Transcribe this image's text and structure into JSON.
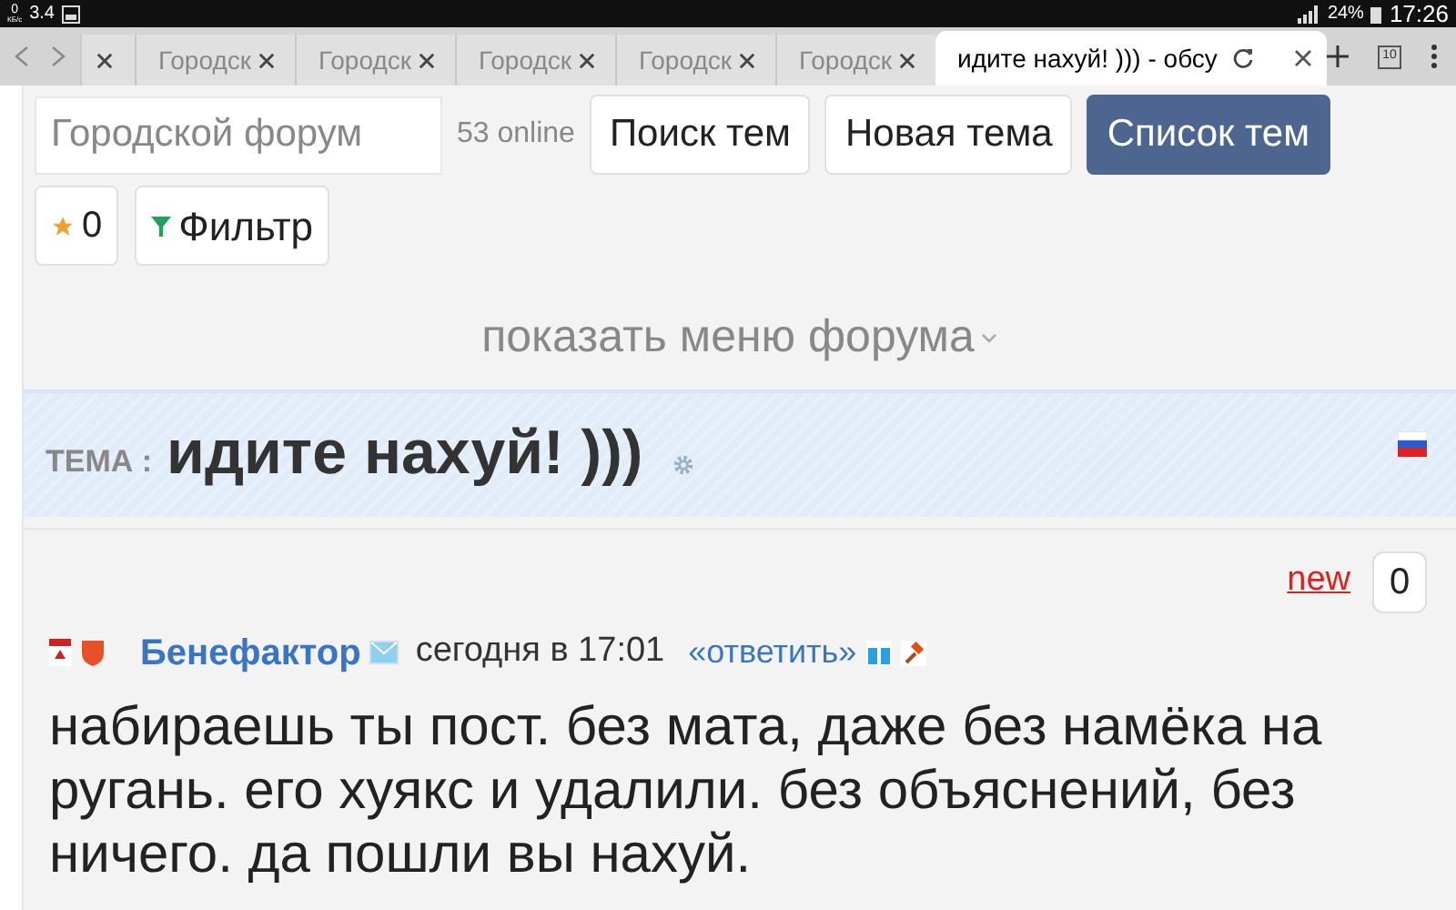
{
  "status_bar": {
    "net_speed": "0",
    "net_unit": "КБ/с",
    "version": "3.4",
    "battery": "24%",
    "time": "17:26"
  },
  "browser": {
    "tabs": [
      {
        "selected": false
      },
      {
        "title": "Городск",
        "selected": false
      },
      {
        "title": "Городск",
        "selected": false
      },
      {
        "title": "Городск",
        "selected": false
      },
      {
        "title": "Городск",
        "selected": false
      },
      {
        "title": "Городск",
        "selected": false
      },
      {
        "title": "идите нахуй! ))) - обсу",
        "selected": true
      }
    ],
    "tab_count": "10"
  },
  "forum_header": {
    "search": {
      "placeholder": "Городской форум"
    },
    "online": "53 online",
    "buttons": [
      {
        "label": "Поиск тем",
        "selected": false
      },
      {
        "label": "Новая тема",
        "selected": false
      },
      {
        "label": "Список тем",
        "selected": true
      }
    ],
    "favorites_count": "0",
    "filter_label": "Фильтр",
    "menu_toggle": "показать меню форума"
  },
  "topic": {
    "prefix": "ТЕМА :",
    "title": "идите нахуй! )))"
  },
  "post": {
    "new_label": "new",
    "counter": "0",
    "author": "Бенефактор",
    "time": "сегодня в 17:01",
    "reply_link": "«ответить»",
    "text": "набираешь ты пост. без мата, даже без намёка на ругань. его хуякс и удалили. без объяснений, без ничего. да пошли вы нахуй."
  }
}
